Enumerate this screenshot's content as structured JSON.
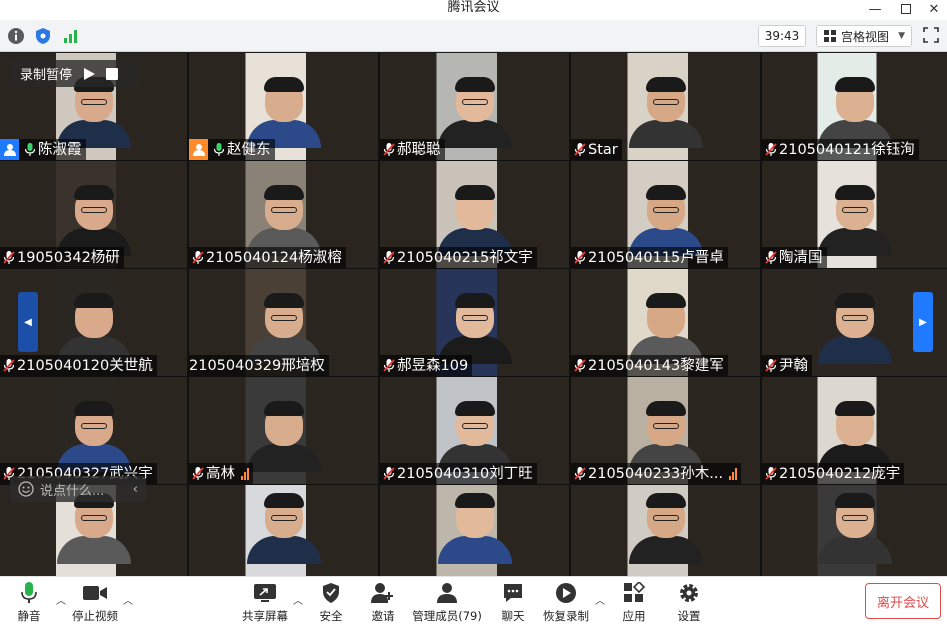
{
  "app": {
    "title": "腾讯会议"
  },
  "toolbar": {
    "timer": "39:43",
    "view_label": "宫格视图"
  },
  "recording": {
    "label": "录制暂停"
  },
  "chat": {
    "placeholder": "说点什么..."
  },
  "bottom": {
    "mute": "静音",
    "stop_video": "停止视频",
    "share": "共享屏幕",
    "security": "安全",
    "invite": "邀请",
    "members": "管理成员(79)",
    "chat": "聊天",
    "resume_record": "恢复录制",
    "apps": "应用",
    "settings": "设置",
    "leave": "离开会议"
  },
  "participants": [
    {
      "name": "陈淑霞",
      "mic": "on",
      "badge": "host-blue"
    },
    {
      "name": "赵健东",
      "mic": "on",
      "badge": "host-orange"
    },
    {
      "name": "郝聪聪",
      "mic": "muted"
    },
    {
      "name": "Star",
      "mic": "muted"
    },
    {
      "name": "2105040121徐钰洵",
      "mic": "muted"
    },
    {
      "name": "19050342杨研",
      "mic": "muted"
    },
    {
      "name": "2105040124杨淑榕",
      "mic": "muted"
    },
    {
      "name": "2105040215祁文宇",
      "mic": "muted"
    },
    {
      "name": "2105040115卢晋卓",
      "mic": "muted"
    },
    {
      "name": "陶清国",
      "mic": "muted"
    },
    {
      "name": "2105040120关世航",
      "mic": "muted"
    },
    {
      "name": "2105040329邢培权",
      "mic": "none"
    },
    {
      "name": "郝昱森109",
      "mic": "muted"
    },
    {
      "name": "2105040143黎建军",
      "mic": "muted"
    },
    {
      "name": "尹翰",
      "mic": "muted"
    },
    {
      "name": "2105040327武兴宇",
      "mic": "muted"
    },
    {
      "name": "高林",
      "mic": "muted",
      "signal": true
    },
    {
      "name": "2105040310刘丁旺",
      "mic": "muted"
    },
    {
      "name": "2105040233孙木...",
      "mic": "muted",
      "signal": true
    },
    {
      "name": "2105040212庞宇",
      "mic": "muted"
    },
    {
      "name": "",
      "mic": "none"
    },
    {
      "name": "",
      "mic": "none"
    },
    {
      "name": "",
      "mic": "none"
    },
    {
      "name": "",
      "mic": "none"
    },
    {
      "name": "",
      "mic": "none"
    }
  ],
  "colors": {
    "accent": "#1f7aff",
    "leave": "#e24a4a",
    "active_speaker": "#3ad36b"
  }
}
